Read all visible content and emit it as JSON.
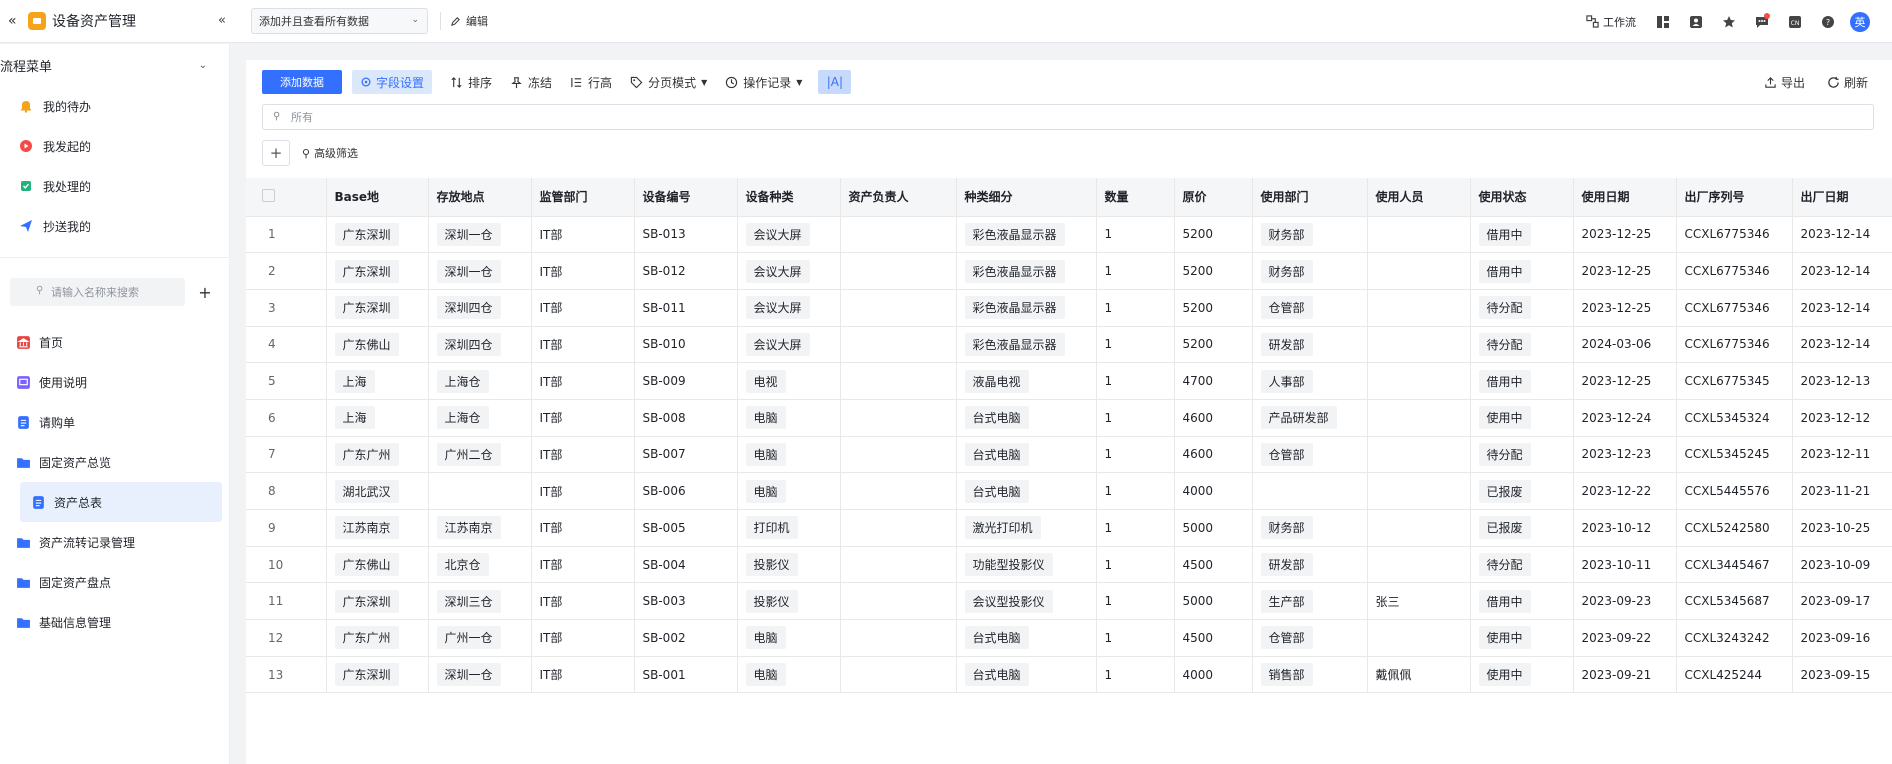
{
  "app": {
    "title": "设备资产管理"
  },
  "topbar": {
    "view_select": "添加并且查看所有数据",
    "edit_label": "编辑",
    "workflow_label": "工作流",
    "lang_label": "CN",
    "avatar_text": "英"
  },
  "sidebar": {
    "flow_menu_label": "流程菜单",
    "flow_items": [
      {
        "label": "我的待办",
        "icon": "bell-icon",
        "color": "#f7a21b"
      },
      {
        "label": "我发起的",
        "icon": "play-circle-icon",
        "color": "#f54a45"
      },
      {
        "label": "我处理的",
        "icon": "check-doc-icon",
        "color": "#20b37e"
      },
      {
        "label": "抄送我的",
        "icon": "send-icon",
        "color": "#3370ff"
      }
    ],
    "search_placeholder": "请输入名称来搜索",
    "nav_items": [
      {
        "label": "首页"
      },
      {
        "label": "使用说明"
      },
      {
        "label": "请购单"
      },
      {
        "label": "固定资产总览"
      },
      {
        "label": "资产总表"
      },
      {
        "label": "资产流转记录管理"
      },
      {
        "label": "固定资产盘点"
      },
      {
        "label": "基础信息管理"
      }
    ]
  },
  "toolbar": {
    "add_label": "添加数据",
    "field_label": "字段设置",
    "sort_label": "排序",
    "freeze_label": "冻结",
    "row_height_label": "行高",
    "paging_label": "分页模式",
    "history_label": "操作记录",
    "aa_label": "|A|",
    "export_label": "导出",
    "refresh_label": "刷新"
  },
  "filter": {
    "placeholder": "所有",
    "advanced_label": "高级筛选"
  },
  "table": {
    "headers": [
      "Base地",
      "存放地点",
      "监管部门",
      "设备编号",
      "设备种类",
      "资产负责人",
      "种类细分",
      "数量",
      "原价",
      "使用部门",
      "使用人员",
      "使用状态",
      "使用日期",
      "出厂序列号",
      "出厂日期"
    ],
    "rows": [
      [
        "1",
        "广东深圳",
        "深圳一仓",
        "IT部",
        "SB-013",
        "会议大屏",
        "",
        "彩色液晶显示器",
        "1",
        "5200",
        "财务部",
        "",
        "借用中",
        "2023-12-25",
        "CCXL6775346",
        "2023-12-14"
      ],
      [
        "2",
        "广东深圳",
        "深圳一仓",
        "IT部",
        "SB-012",
        "会议大屏",
        "",
        "彩色液晶显示器",
        "1",
        "5200",
        "财务部",
        "",
        "借用中",
        "2023-12-25",
        "CCXL6775346",
        "2023-12-14"
      ],
      [
        "3",
        "广东深圳",
        "深圳四仓",
        "IT部",
        "SB-011",
        "会议大屏",
        "",
        "彩色液晶显示器",
        "1",
        "5200",
        "仓管部",
        "",
        "待分配",
        "2023-12-25",
        "CCXL6775346",
        "2023-12-14"
      ],
      [
        "4",
        "广东佛山",
        "深圳四仓",
        "IT部",
        "SB-010",
        "会议大屏",
        "",
        "彩色液晶显示器",
        "1",
        "5200",
        "研发部",
        "",
        "待分配",
        "2024-03-06",
        "CCXL6775346",
        "2023-12-14"
      ],
      [
        "5",
        "上海",
        "上海仓",
        "IT部",
        "SB-009",
        "电视",
        "",
        "液晶电视",
        "1",
        "4700",
        "人事部",
        "",
        "借用中",
        "2023-12-25",
        "CCXL6775345",
        "2023-12-13"
      ],
      [
        "6",
        "上海",
        "上海仓",
        "IT部",
        "SB-008",
        "电脑",
        "",
        "台式电脑",
        "1",
        "4600",
        "产品研发部",
        "",
        "使用中",
        "2023-12-24",
        "CCXL5345324",
        "2023-12-12"
      ],
      [
        "7",
        "广东广州",
        "广州二仓",
        "IT部",
        "SB-007",
        "电脑",
        "",
        "台式电脑",
        "1",
        "4600",
        "仓管部",
        "",
        "待分配",
        "2023-12-23",
        "CCXL5345245",
        "2023-12-11"
      ],
      [
        "8",
        "湖北武汉",
        "",
        "IT部",
        "SB-006",
        "电脑",
        "",
        "台式电脑",
        "1",
        "4000",
        "",
        "",
        "已报废",
        "2023-12-22",
        "CCXL5445576",
        "2023-11-21"
      ],
      [
        "9",
        "江苏南京",
        "江苏南京",
        "IT部",
        "SB-005",
        "打印机",
        "",
        "激光打印机",
        "1",
        "5000",
        "财务部",
        "",
        "已报废",
        "2023-10-12",
        "CCXL5242580",
        "2023-10-25"
      ],
      [
        "10",
        "广东佛山",
        "北京仓",
        "IT部",
        "SB-004",
        "投影仪",
        "",
        "功能型投影仪",
        "1",
        "4500",
        "研发部",
        "",
        "待分配",
        "2023-10-11",
        "CCXL3445467",
        "2023-10-09"
      ],
      [
        "11",
        "广东深圳",
        "深圳三仓",
        "IT部",
        "SB-003",
        "投影仪",
        "",
        "会议型投影仪",
        "1",
        "5000",
        "生产部",
        "张三",
        "借用中",
        "2023-09-23",
        "CCXL5345687",
        "2023-09-17"
      ],
      [
        "12",
        "广东广州",
        "广州一仓",
        "IT部",
        "SB-002",
        "电脑",
        "",
        "台式电脑",
        "1",
        "4500",
        "仓管部",
        "",
        "使用中",
        "2023-09-22",
        "CCXL3243242",
        "2023-09-16"
      ],
      [
        "13",
        "广东深圳",
        "深圳一仓",
        "IT部",
        "SB-001",
        "电脑",
        "",
        "台式电脑",
        "1",
        "4000",
        "销售部",
        "戴佩佩",
        "使用中",
        "2023-09-21",
        "CCXL425244",
        "2023-09-15"
      ]
    ]
  }
}
